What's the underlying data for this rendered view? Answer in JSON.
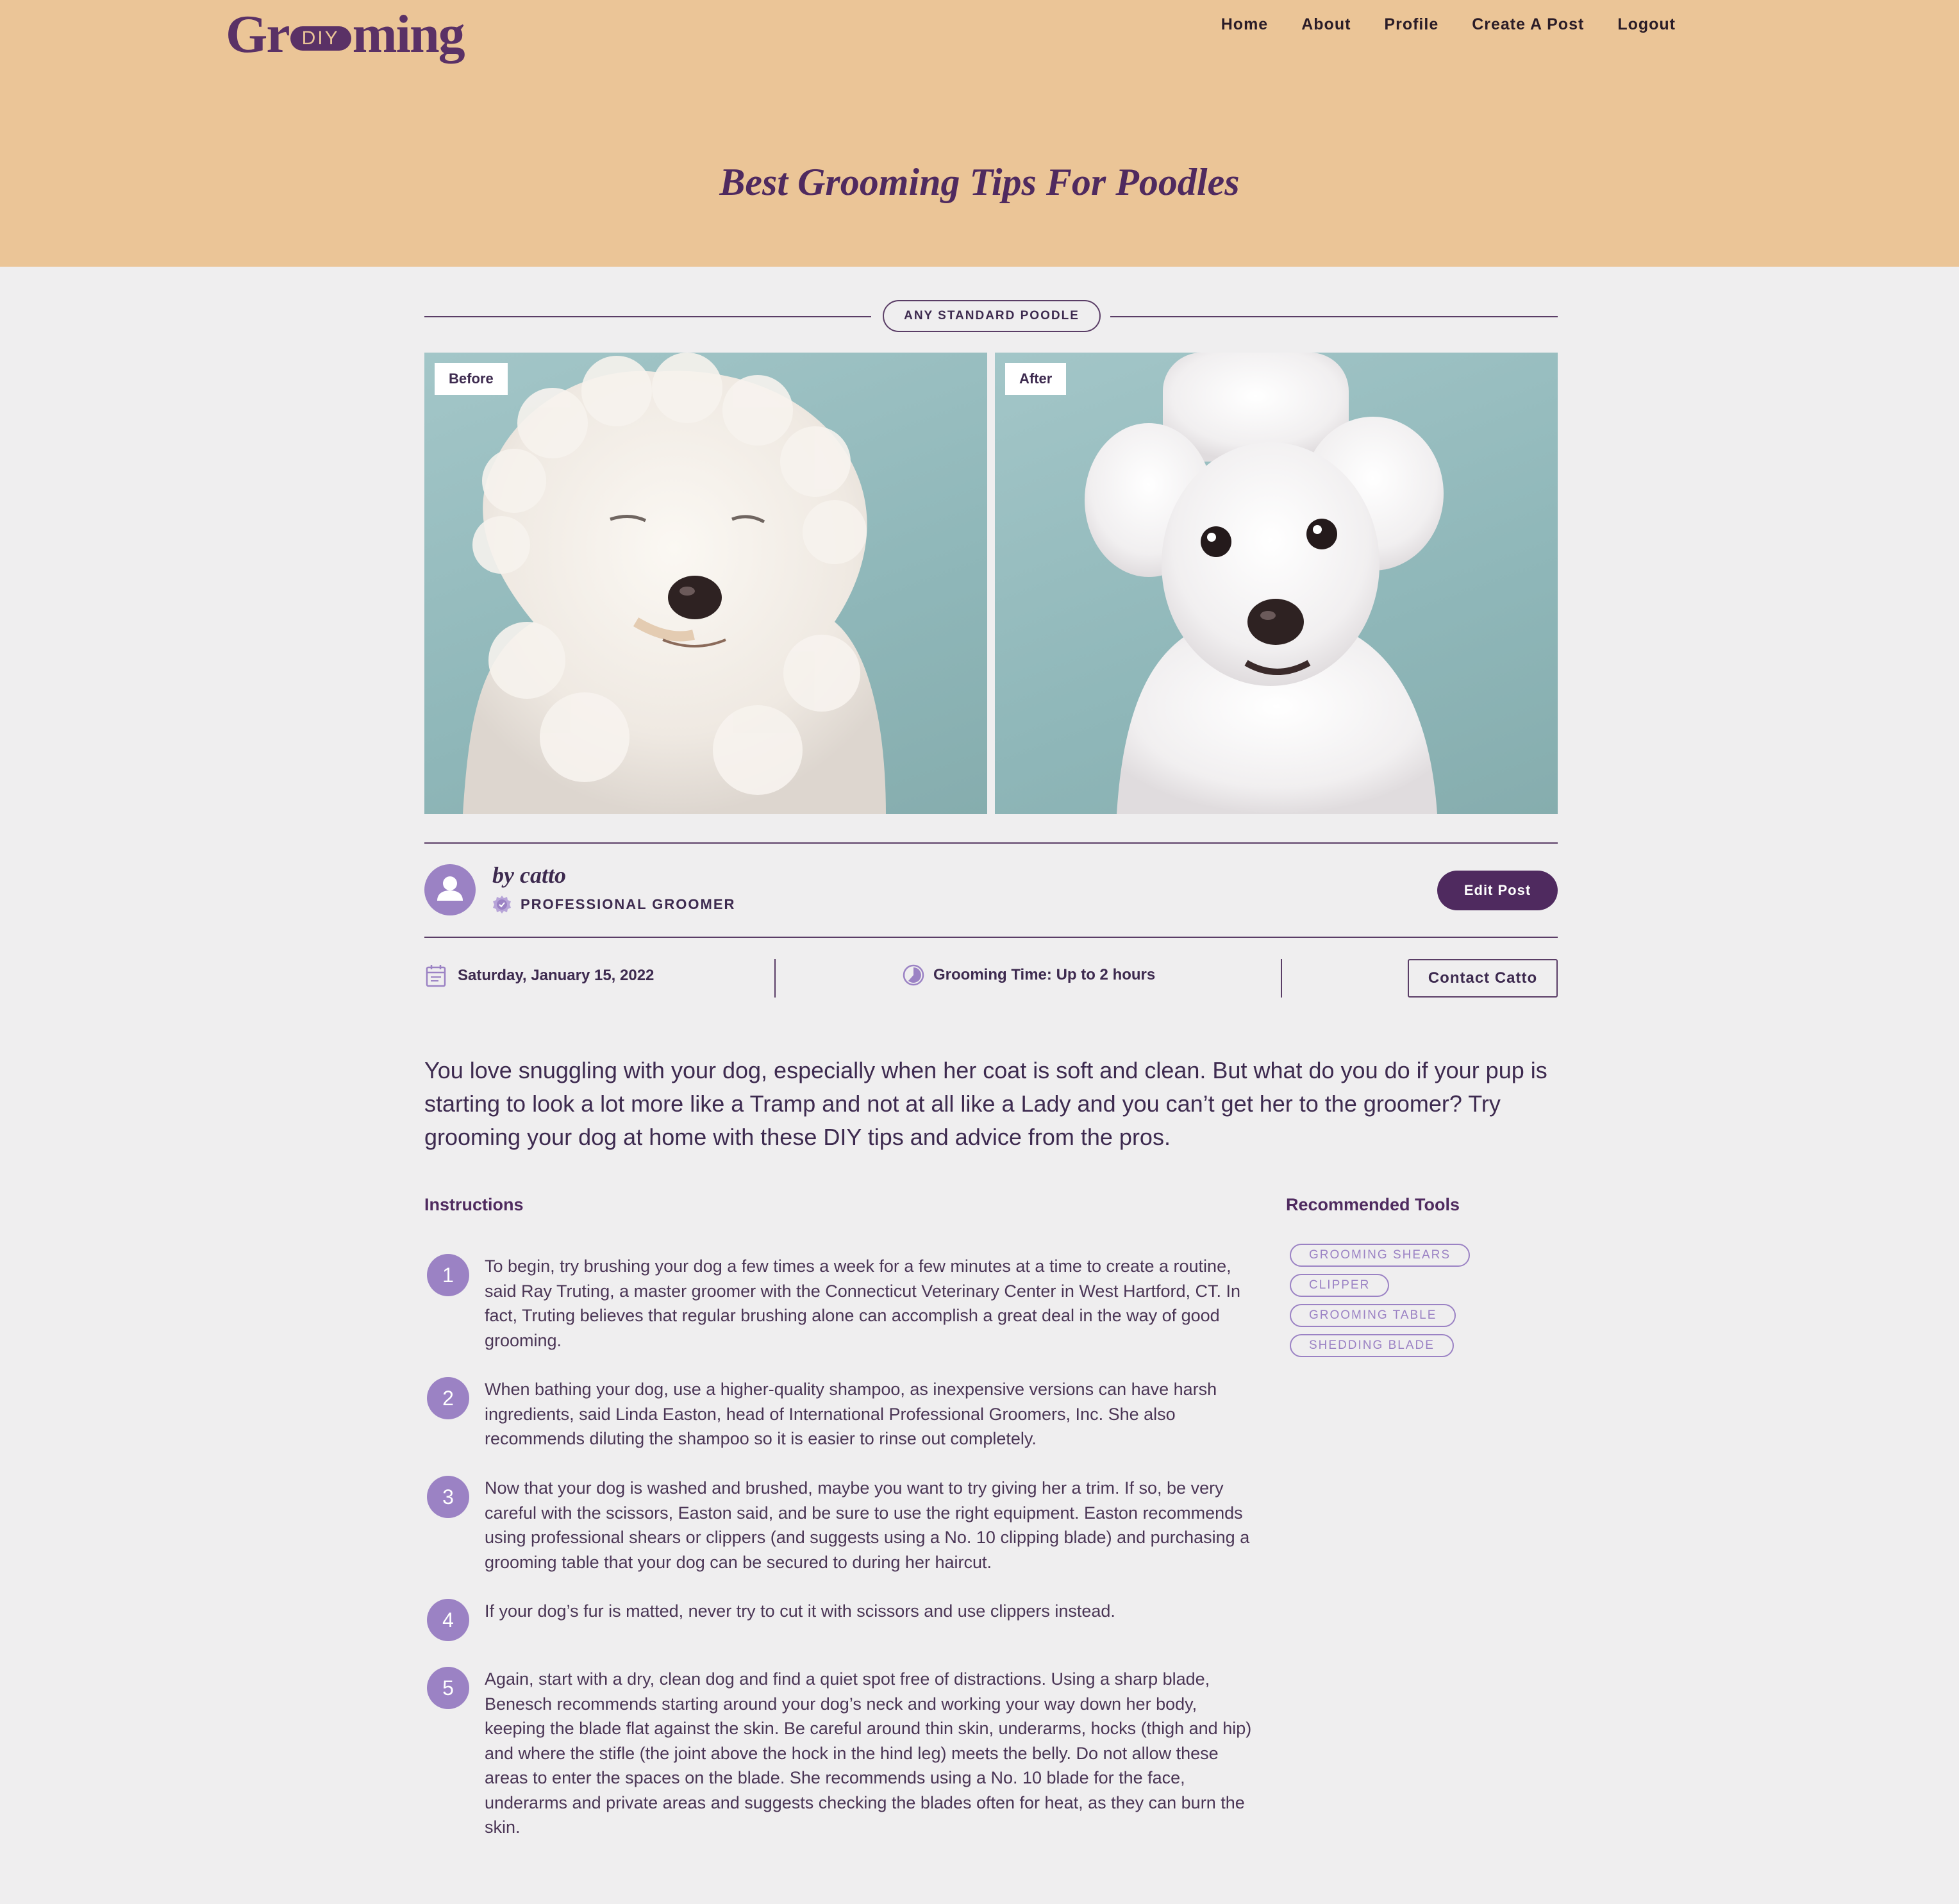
{
  "brand": {
    "logo_left": "Gr",
    "logo_pill": "DIY",
    "logo_right": "ming"
  },
  "nav": [
    "Home",
    "About",
    "Profile",
    "Create A Post",
    "Logout"
  ],
  "post": {
    "title": "Best Grooming Tips For Poodles",
    "category": "ANY STANDARD POODLE",
    "before_label": "Before",
    "after_label": "After"
  },
  "author": {
    "name": "by catto",
    "role": "PROFESSIONAL GROOMER",
    "edit_label": "Edit Post"
  },
  "meta": {
    "date": "Saturday, January 15, 2022",
    "grooming_time": "Grooming Time: Up to 2 hours",
    "contact_label": "Contact Catto"
  },
  "intro": "You love snuggling with your dog, especially when her coat is soft and clean. But what do you do if your pup is starting to look a lot more like a Tramp and not at all like a Lady and you can’t get her to the groomer? Try grooming your dog at home with these DIY tips and advice from the pros.",
  "instructions": {
    "heading": "Instructions",
    "steps": [
      {
        "num": "1",
        "text": "To begin, try brushing your dog a few times a week for a few minutes at a time to create a routine, said Ray Truting, a master groomer with the Connecticut Veterinary Center in West Hartford, CT. In fact, Truting believes that regular brushing alone can accomplish a great deal in the way of good grooming."
      },
      {
        "num": "2",
        "text": "When bathing your dog, use a higher-quality shampoo, as inexpensive versions can have harsh ingredients, said Linda Easton, head of International Professional Groomers, Inc. She also recommends diluting the shampoo so it is easier to rinse out completely."
      },
      {
        "num": "3",
        "text": "Now that your dog is washed and brushed, maybe you want to try giving her a trim. If so, be very careful with the scissors, Easton said, and be sure to use the right equipment. Easton recommends using professional shears or clippers (and suggests using a No. 10 clipping blade) and purchasing a grooming table that your dog can be secured to during her haircut."
      },
      {
        "num": "4",
        "text": "If your dog’s fur is matted, never try to cut it with scissors and use clippers instead."
      },
      {
        "num": "5",
        "text": "Again, start with a dry, clean dog and find a quiet spot free of distractions. Using a sharp blade, Benesch recommends starting around your dog’s neck and working your way down her body, keeping the blade flat against the skin. Be careful around thin skin, underarms, hocks (thigh and hip) and where the stifle (the joint above the hock in the hind leg) meets the belly. Do not allow these areas to enter the spaces on the blade. She recommends using a No. 10 blade for the face, underarms and private areas and suggests checking the blades often for heat, as they can burn the skin."
      }
    ]
  },
  "tools": {
    "heading": "Recommended Tools",
    "items": [
      "GROOMING SHEARS",
      "CLIPPER",
      "GROOMING TABLE",
      "SHEDDING BLADE"
    ]
  },
  "colors": {
    "header_bg": "#ebc597",
    "primary": "#4f2a5f",
    "accent": "#9b82c4",
    "page_bg": "#efeeef",
    "photo_bg": "#9fc3c5"
  }
}
